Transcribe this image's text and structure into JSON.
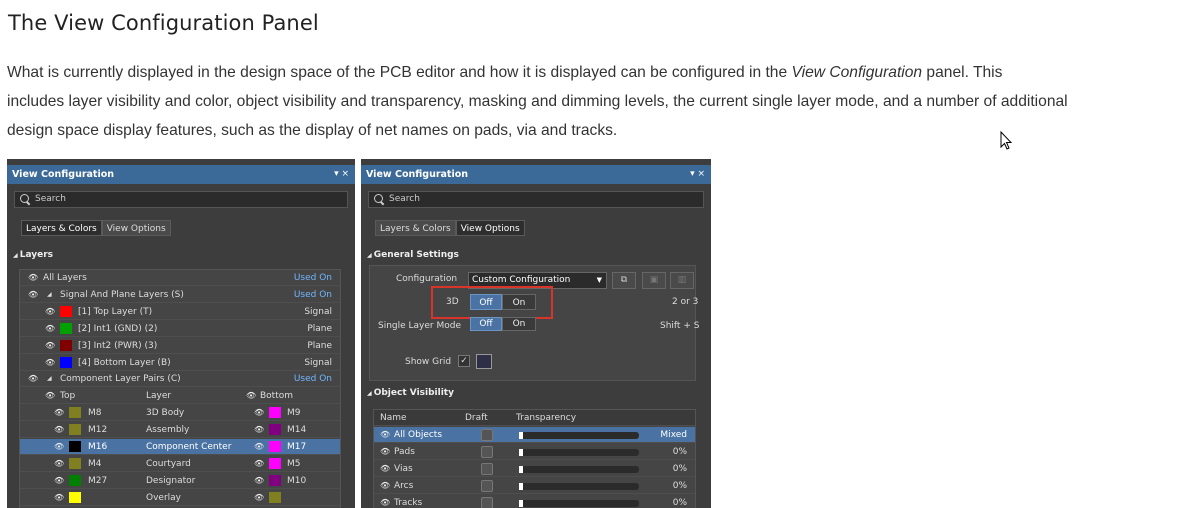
{
  "heading": "The View Configuration Panel",
  "para": {
    "part1": "What is currently displayed in the design space of the PCB editor and how it is displayed can be configured in the ",
    "em": "View Configuration",
    "part2": " panel. This",
    "line2": "includes layer visibility and color, object visibility and transparency, masking and dimming levels, the current single layer mode, and a number of additional",
    "line3": "design space display features, such as the display of net names on pads, via and tracks."
  },
  "left_panel": {
    "title": "View Configuration",
    "controls": "▾ ×",
    "search_placeholder": "Search",
    "tabs": [
      "Layers & Colors",
      "View Options"
    ],
    "section": "Layers",
    "all_layers": {
      "label": "All Layers",
      "status": "Used On"
    },
    "signal_group": {
      "label": "Signal And Plane Layers (S)",
      "status": "Used On"
    },
    "signal_layers": [
      {
        "name": "[1] Top Layer (T)",
        "type": "Signal",
        "color": "#ff0000"
      },
      {
        "name": "[2] Int1 (GND) (2)",
        "type": "Plane",
        "color": "#00a000"
      },
      {
        "name": "[3] Int2 (PWR) (3)",
        "type": "Plane",
        "color": "#800000"
      },
      {
        "name": "[4] Bottom Layer (B)",
        "type": "Signal",
        "color": "#0000ff"
      }
    ],
    "component_group": {
      "label": "Component Layer Pairs (C)",
      "status": "Used On"
    },
    "pair_headers": {
      "top": "Top",
      "layer": "Layer",
      "bottom": "Bottom"
    },
    "pairs": [
      {
        "top": "M8",
        "top_color": "#808020",
        "layer": "3D Body",
        "bottom": "M9",
        "bottom_color": "#ff00ff"
      },
      {
        "top": "M12",
        "top_color": "#808020",
        "layer": "Assembly",
        "bottom": "M14",
        "bottom_color": "#800080"
      },
      {
        "top": "M16",
        "top_color": "#000000",
        "layer": "Component Center",
        "bottom": "M17",
        "bottom_color": "#ff00ff"
      },
      {
        "top": "M4",
        "top_color": "#808020",
        "layer": "Courtyard",
        "bottom": "M5",
        "bottom_color": "#ff00ff"
      },
      {
        "top": "M27",
        "top_color": "#008000",
        "layer": "Designator",
        "bottom": "M10",
        "bottom_color": "#800080"
      },
      {
        "top": "",
        "top_color": "#ffff00",
        "layer": "Overlay",
        "bottom": "",
        "bottom_color": "#808020"
      }
    ]
  },
  "right_panel": {
    "title": "View Configuration",
    "controls": "▾ ×",
    "search_placeholder": "Search",
    "tabs": [
      "Layers & Colors",
      "View Options"
    ],
    "general_section": "General Settings",
    "configuration_label": "Configuration",
    "configuration_value": "Custom Configuration",
    "threed_label": "3D",
    "threed_off": "Off",
    "threed_on": "On",
    "threed_shortcut": "2 or 3",
    "single_layer_label": "Single Layer Mode",
    "single_off": "Off",
    "single_on": "On",
    "single_shortcut": "Shift + S",
    "show_grid_label": "Show Grid",
    "object_section": "Object Visibility",
    "columns": {
      "name": "Name",
      "draft": "Draft",
      "transparency": "Transparency"
    },
    "objects": [
      {
        "name": "All Objects",
        "value": "Mixed",
        "level": 0.03,
        "selected": true
      },
      {
        "name": "Pads",
        "value": "0%",
        "level": 0.03,
        "selected": false
      },
      {
        "name": "Vias",
        "value": "0%",
        "level": 0.03,
        "selected": false
      },
      {
        "name": "Arcs",
        "value": "0%",
        "level": 0.03,
        "selected": false
      },
      {
        "name": "Tracks",
        "value": "0%",
        "level": 0.03,
        "selected": false
      }
    ]
  }
}
